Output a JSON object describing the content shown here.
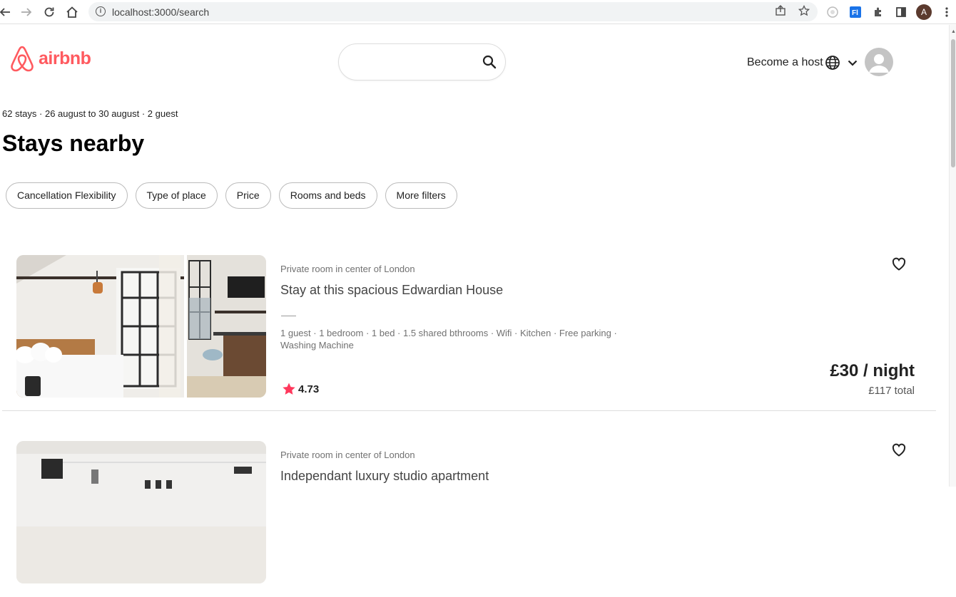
{
  "browser": {
    "url": "localhost:3000/search",
    "profile_initial": "A"
  },
  "header": {
    "logo_text": "airbnb",
    "brand_color": "#ff5a5f",
    "search_placeholder": "",
    "host_label": "Become a host"
  },
  "summary": "62 stays · 26 august to 30 august · 2 guest",
  "heading": "Stays nearby",
  "filters": [
    "Cancellation Flexibility",
    "Type of place",
    "Price",
    "Rooms and beds",
    "More filters"
  ],
  "listings": [
    {
      "type": "Private room in center of London",
      "title": "Stay at this spacious Edwardian House",
      "features": "1 guest · 1 bedroom · 1 bed · 1.5 shared bthrooms · Wifi · Kitchen · Free parking · Washing Machine",
      "rating": "4.73",
      "price": "£30 / night",
      "total": "£117 total"
    },
    {
      "type": "Private room in center of London",
      "title": "Independant luxury studio apartment"
    }
  ]
}
